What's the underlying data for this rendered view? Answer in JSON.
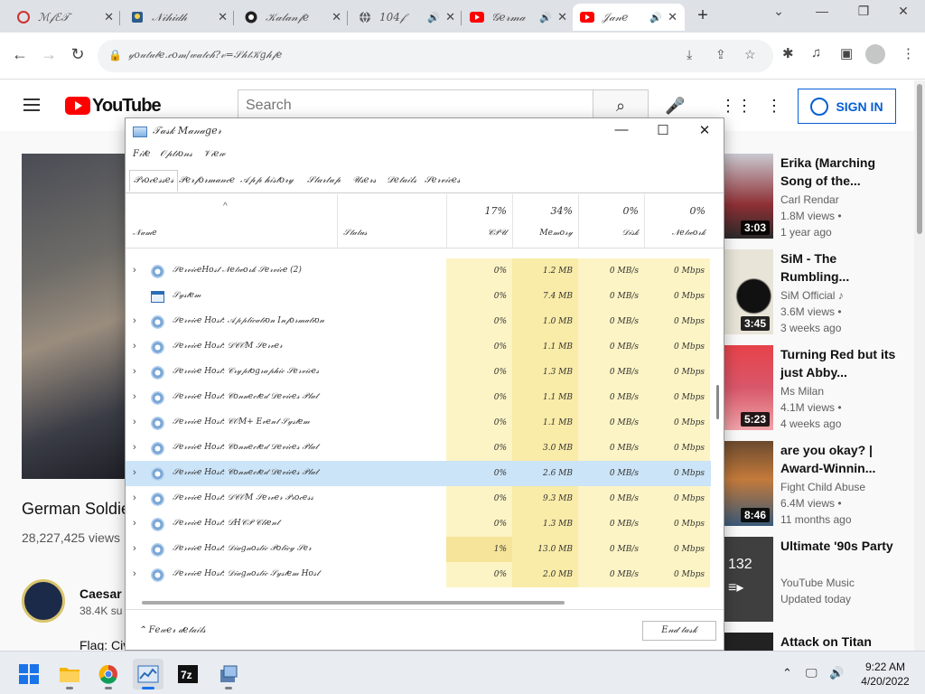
{
  "browser": {
    "tabs": [
      {
        "title": "ℳ𝒻ℰ𝒯",
        "favicon": "generic-site-icon",
        "audio": false
      },
      {
        "title": "𝒩𝒾𝒽𝒾𝒹𝒽",
        "favicon": "character-icon",
        "audio": false
      },
      {
        "title": "𝒦𝒶𝓁𝒶𝓃𝒻𝑒",
        "favicon": "github-icon",
        "audio": false
      },
      {
        "title": "104𝒻",
        "favicon": "globe-icon",
        "audio": true
      },
      {
        "title": "𝒢𝑒𝓇𝓂𝒶",
        "favicon": "youtube-icon",
        "audio": true
      },
      {
        "title": "𝒥𝒶𝓃𝑒",
        "favicon": "youtube-icon",
        "audio": true,
        "active": true
      }
    ],
    "url": "𝓎𝑜𝓊𝓉𝓊𝒷𝑒.𝒸𝑜𝓂/𝓌𝒶𝓉𝒸𝒽?𝓋=𝒮𝒽𝓉𝒦𝑔𝒽𝒻𝑒"
  },
  "youtube": {
    "logo_text": "YouTube",
    "search_placeholder": "Search",
    "sign_in_label": "SIGN IN",
    "video": {
      "title": "German Soldie",
      "views": "28,227,425 views",
      "channel": "Caesar A",
      "subs": "38.4K su",
      "desc": "Flag: Civ"
    },
    "recommendations": [
      {
        "title": "Erika (Marching Song of the...",
        "channel": "Carl Rendar",
        "views": "1.8M views •",
        "age": "1 year ago",
        "duration": "3:03"
      },
      {
        "title": "SiM - The Rumbling...",
        "channel": "SiM Official ♪",
        "views": "3.6M views •",
        "age": "3 weeks ago",
        "duration": "3:45"
      },
      {
        "title": "Turning Red but its just Abby...",
        "channel": "Ms Milan",
        "views": "4.1M views •",
        "age": "4 weeks ago",
        "duration": "5:23"
      },
      {
        "title": "are you okay? | Award-Winnin...",
        "channel": "Fight Child Abuse",
        "views": "6.4M views •",
        "age": "11 months ago",
        "duration": "8:46"
      },
      {
        "title": "Ultimate '90s Party",
        "channel": "YouTube Music",
        "views": "Updated today",
        "age": "",
        "duration": "132"
      },
      {
        "title": "Attack on Titan",
        "channel": "",
        "views": "",
        "age": "",
        "duration": ""
      }
    ]
  },
  "taskmanager": {
    "title": "𝒯𝒶𝓈𝓀 𝑀𝒶𝓃𝒶𝑔𝑒𝓇",
    "menu": [
      "𝐹𝒾𝓁𝑒",
      "𝒪𝓅𝓉𝒾𝑜𝓃𝓈",
      "𝒱𝒾𝑒𝓌"
    ],
    "tabs": [
      "𝒫𝓇𝑜𝒸𝑒𝓈𝓈𝑒𝓈",
      "𝒫𝑒𝓇𝒻𝑜𝓇𝓂𝒶𝓃𝒸𝑒",
      "𝒜𝓅𝓅 𝒽𝒾𝓈𝓉𝑜𝓇𝓎",
      "𝒮𝓉𝒶𝓇𝓉𝓊𝓅",
      "𝒰𝓈𝑒𝓇𝓈",
      "𝒟𝑒𝓉𝒶𝒾𝓁𝓈",
      "𝒮𝑒𝓇𝓋𝒾𝒸𝑒𝓈"
    ],
    "columns": {
      "name": "𝒩𝒶𝓂𝑒",
      "status": "𝒮𝓉𝒶𝓉𝓊𝓈",
      "cpu_pct": "17%",
      "cpu": "𝒞𝒫𝒰",
      "mem_pct": "34%",
      "mem": "𝑀𝑒𝓂𝑜𝓇𝓎",
      "disk_pct": "0%",
      "disk": "𝒟𝒾𝓈𝓀",
      "net_pct": "0%",
      "net": "𝒩𝑒𝓉𝓌𝑜𝓇𝓀"
    },
    "rows": [
      {
        "name": "𝒮𝑒𝓇𝓋𝒾𝒸𝑒𝐻𝑜𝓈𝓉 𝒩𝑒𝓉𝓌𝑜𝓇𝓀 𝒮𝑒𝓇𝓋𝒾𝒸𝑒 (2)",
        "cpu": "0%",
        "mem": "1.2 MB",
        "disk": "0 MB/s",
        "net": "0 Mbps",
        "icon": "gear",
        "expand": true
      },
      {
        "name": "𝒮𝓎𝓈𝓉𝑒𝓂",
        "cpu": "0%",
        "mem": "7.4 MB",
        "disk": "0 MB/s",
        "net": "0 Mbps",
        "icon": "window",
        "expand": false
      },
      {
        "name": "𝒮𝑒𝓇𝓋𝒾𝒸𝑒 𝐻𝑜𝓈𝓉: 𝒜𝓅𝓅𝓁𝒾𝒸𝒶𝓉𝒾𝑜𝓃 𝐼𝓃𝒻𝑜𝓇𝓂𝒶𝓉𝒾𝑜𝓃",
        "cpu": "0%",
        "mem": "1.0 MB",
        "disk": "0 MB/s",
        "net": "0 Mbps",
        "icon": "gear",
        "expand": true
      },
      {
        "name": "𝒮𝑒𝓇𝓋𝒾𝒸𝑒 𝐻𝑜𝓈𝓉: 𝒟𝒞𝒪𝑀 𝒮𝑒𝓇𝓋𝑒𝓇",
        "cpu": "0%",
        "mem": "1.1 MB",
        "disk": "0 MB/s",
        "net": "0 Mbps",
        "icon": "gear",
        "expand": true
      },
      {
        "name": "𝒮𝑒𝓇𝓋𝒾𝒸𝑒 𝐻𝑜𝓈𝓉: 𝒞𝓇𝓎𝓅𝓉𝑜𝑔𝓇𝒶𝓅𝒽𝒾𝒸 𝒮𝑒𝓇𝓋𝒾𝒸𝑒𝓈",
        "cpu": "0%",
        "mem": "1.3 MB",
        "disk": "0 MB/s",
        "net": "0 Mbps",
        "icon": "gear",
        "expand": true
      },
      {
        "name": "𝒮𝑒𝓇𝓋𝒾𝒸𝑒 𝐻𝑜𝓈𝓉: 𝒞𝑜𝓃𝓃𝑒𝒸𝓉𝑒𝒹 𝒟𝑒𝓋𝒾𝒸𝑒𝓈 𝒫𝓁𝒶𝓉",
        "cpu": "0%",
        "mem": "1.1 MB",
        "disk": "0 MB/s",
        "net": "0 Mbps",
        "icon": "gear",
        "expand": true
      },
      {
        "name": "𝒮𝑒𝓇𝓋𝒾𝒸𝑒 𝐻𝑜𝓈𝓉: 𝒞𝒪𝑀+ 𝐸𝓋𝑒𝓃𝓉 𝒮𝓎𝓈𝓉𝑒𝓂",
        "cpu": "0%",
        "mem": "1.1 MB",
        "disk": "0 MB/s",
        "net": "0 Mbps",
        "icon": "gear",
        "expand": true
      },
      {
        "name": "𝒮𝑒𝓇𝓋𝒾𝒸𝑒 𝐻𝑜𝓈𝓉: 𝒞𝑜𝓃𝓃𝑒𝒸𝓉𝑒𝒹 𝒟𝑒𝓋𝒾𝒸𝑒𝓈 𝒫𝓁𝒶𝓉",
        "cpu": "0%",
        "mem": "3.0 MB",
        "disk": "0 MB/s",
        "net": "0 Mbps",
        "icon": "gear",
        "expand": true
      },
      {
        "name": "𝒮𝑒𝓇𝓋𝒾𝒸𝑒 𝐻𝑜𝓈𝓉: 𝒞𝑜𝓃𝓃𝑒𝒸𝓉𝑒𝒹 𝒟𝑒𝓋𝒾𝒸𝑒𝓈 𝒫𝓁𝒶𝓉",
        "cpu": "0%",
        "mem": "2.6 MB",
        "disk": "0 MB/s",
        "net": "0 Mbps",
        "icon": "gear",
        "expand": true,
        "selected": true
      },
      {
        "name": "𝒮𝑒𝓇𝓋𝒾𝒸𝑒 𝐻𝑜𝓈𝓉: 𝒟𝒞𝒪𝑀 𝒮𝑒𝓇𝓋𝑒𝓇 𝒫𝓇𝑜𝒸𝑒𝓈𝓈",
        "cpu": "0%",
        "mem": "9.3 MB",
        "disk": "0 MB/s",
        "net": "0 Mbps",
        "icon": "gear",
        "expand": true
      },
      {
        "name": "𝒮𝑒𝓇𝓋𝒾𝒸𝑒 𝐻𝑜𝓈𝓉: 𝒟𝐻𝒞𝒫 𝒞𝓁𝒾𝑒𝓃𝓉",
        "cpu": "0%",
        "mem": "1.3 MB",
        "disk": "0 MB/s",
        "net": "0 Mbps",
        "icon": "gear",
        "expand": true
      },
      {
        "name": "𝒮𝑒𝓇𝓋𝒾𝒸𝑒 𝐻𝑜𝓈𝓉: 𝒟𝒾𝒶𝑔𝓃𝑜𝓈𝓉𝒾𝒸 𝒫𝑜𝓁𝒾𝒸𝓎 𝒮𝑒𝓇",
        "cpu": "1%",
        "mem": "13.0 MB",
        "disk": "0 MB/s",
        "net": "0 Mbps",
        "icon": "gear",
        "expand": true,
        "cpu_hi": true
      },
      {
        "name": "𝒮𝑒𝓇𝓋𝒾𝒸𝑒 𝐻𝑜𝓈𝓉: 𝒟𝒾𝒶𝑔𝓃𝑜𝓈𝓉𝒾𝒸 𝒮𝓎𝓈𝓉𝑒𝓂 𝐻𝑜𝓈𝓉",
        "cpu": "0%",
        "mem": "2.0 MB",
        "disk": "0 MB/s",
        "net": "0 Mbps",
        "icon": "gear",
        "expand": true
      }
    ],
    "fewer_details": "𝐹𝑒𝓌𝑒𝓇 𝒹𝑒𝓉𝒶𝒾𝓁𝓈",
    "end_task": "𝐸𝓃𝒹 𝓉𝒶𝓈𝓀"
  },
  "taskbar": {
    "apps": [
      "start-button",
      "file-explorer",
      "chrome",
      "task-manager",
      "7zip",
      "installer"
    ],
    "time": "9:22 AM",
    "date": "4/20/2022"
  }
}
